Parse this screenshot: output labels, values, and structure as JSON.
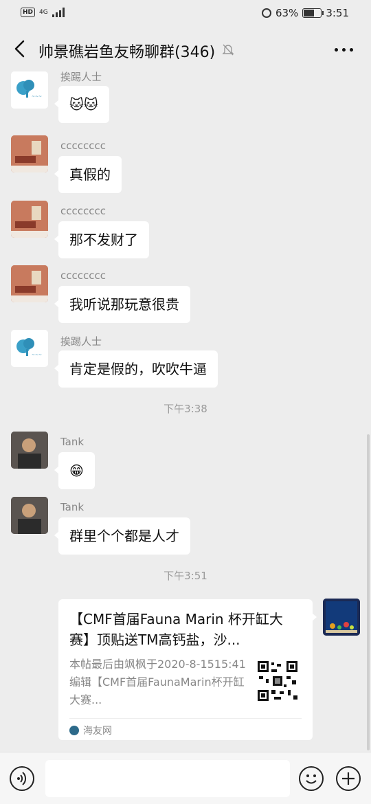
{
  "status_bar": {
    "hd": "HD",
    "network": "4G",
    "battery_percent": "63%",
    "battery_level": 0.63,
    "time": "3:51"
  },
  "header": {
    "back_icon": "chevron-left-icon",
    "title": "帅景礁岩鱼友畅聊群(346)",
    "mute_icon": "bell-off-icon",
    "more_icon": "more-dots-icon"
  },
  "messages": [
    {
      "sender": "挨踢人士",
      "text": "🐱🐱"
    },
    {
      "sender": "cccccccc",
      "text": "真假的"
    },
    {
      "sender": "cccccccc",
      "text": "那不发财了"
    },
    {
      "sender": "cccccccc",
      "text": "我听说那玩意很贵"
    },
    {
      "sender": "挨踢人士",
      "text": "肯定是假的，吹吹牛逼"
    },
    {
      "sender": "Tank",
      "text": "😁"
    },
    {
      "sender": "Tank",
      "text": "群里个个都是人才"
    }
  ],
  "timestamps": [
    "下午3:38",
    "下午3:51"
  ],
  "link_card": {
    "title": "【CMF首届Fauna Marin 杯开缸大赛】顶贴送TM高钙盐，沙...",
    "description": "本帖最后由飒枫于2020-8-1515:41编辑【CMF首届FaunaMarin杯开缸大赛...",
    "source": "海友网"
  },
  "input_bar": {
    "voice_icon": "voice-icon",
    "emoji_icon": "emoji-icon",
    "plus_icon": "plus-icon"
  },
  "colors": {
    "background": "#ededed",
    "bubble": "#ffffff"
  }
}
